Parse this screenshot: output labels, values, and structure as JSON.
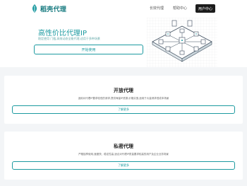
{
  "header": {
    "brand": "稻壳代理",
    "nav": [
      "长效代理",
      "帮助中心"
    ],
    "user_button": "用户中心"
  },
  "hero": {
    "title": "高性价比代理IP",
    "subtitle": "稳定使用 门槛,高效动态全能代理,适用于多种场景",
    "cta": "开始使用"
  },
  "cards": [
    {
      "title": "开放代理",
      "description": "适用对代理IP要求较低的请求,提供海量IP资源,价格实惠,适用于大量请求低成本场景",
      "button": "了解更多"
    },
    {
      "title": "私密代理",
      "description": "严格独享使用,速度快、稳定性高,适合对代理IP质量要求较高的用户及企业业务场景",
      "button": "了解更多"
    }
  ],
  "colors": {
    "accent": "#1c9aa0",
    "brand": "#12787d",
    "dark_button": "#1c1c1c"
  }
}
